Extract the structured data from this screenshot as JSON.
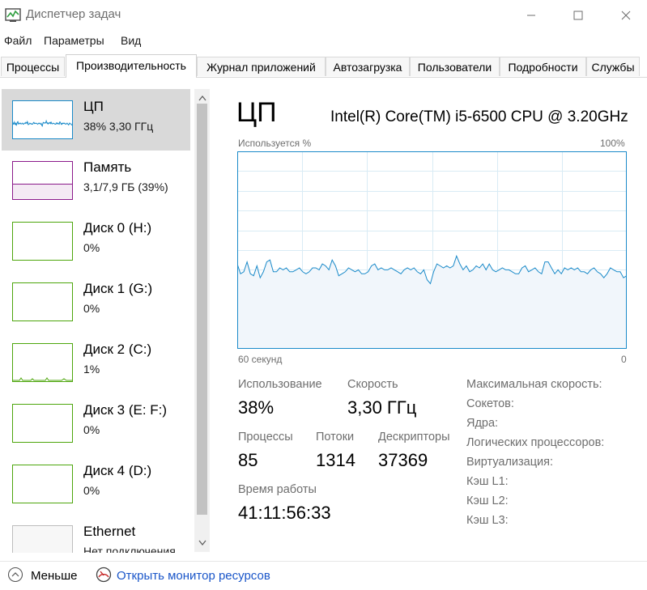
{
  "window": {
    "title": "Диспетчер задач",
    "minimize_icon": "minimize-icon",
    "maximize_icon": "maximize-icon",
    "close_icon": "close-icon"
  },
  "menu": [
    "Файл",
    "Параметры",
    "Вид"
  ],
  "tabs": [
    "Процессы",
    "Производительность",
    "Журнал приложений",
    "Автозагрузка",
    "Пользователи",
    "Подробности",
    "Службы"
  ],
  "active_tab": "Производительность",
  "sidebar": {
    "items": [
      {
        "name": "ЦП",
        "sub": "38% 3,30 ГГц",
        "color": "#1a8ac9",
        "selected": true
      },
      {
        "name": "Память",
        "sub": "3,1/7,9 ГБ (39%)",
        "color": "#8b1a8b"
      },
      {
        "name": "Диск 0 (H:)",
        "sub": "0%",
        "color": "#4da60c"
      },
      {
        "name": "Диск 1 (G:)",
        "sub": "0%",
        "color": "#4da60c"
      },
      {
        "name": "Диск 2 (C:)",
        "sub": "1%",
        "color": "#4da60c"
      },
      {
        "name": "Диск 3 (E: F:)",
        "sub": "0%",
        "color": "#4da60c"
      },
      {
        "name": "Диск 4 (D:)",
        "sub": "0%",
        "color": "#4da60c"
      },
      {
        "name": "Ethernet",
        "sub": "Нет подключения",
        "color": "#bdbdbd"
      }
    ]
  },
  "main": {
    "title": "ЦП",
    "cpu_model": "Intel(R) Core(TM) i5-6500 CPU @ 3.20GHz",
    "graph_top_left": "Используется %",
    "graph_top_right": "100%",
    "graph_bottom_left": "60 секунд",
    "graph_bottom_right": "0",
    "graph_color": "#1a8ac9",
    "graph_fill": "#f1f6fb",
    "graph_grid": "#d9ebf5",
    "cpu_usage_history": [
      43,
      38,
      39,
      44,
      38,
      37,
      42,
      36,
      39,
      44,
      45,
      39,
      39,
      41,
      40,
      41,
      39,
      39,
      40,
      41,
      39,
      38,
      39,
      41,
      41,
      40,
      43,
      42,
      40,
      45,
      42,
      37,
      38,
      39,
      41,
      40,
      39,
      40,
      38,
      38,
      39,
      42,
      43,
      40,
      41,
      40,
      40,
      41,
      40,
      39,
      38,
      40,
      41,
      40,
      41,
      39,
      38,
      40,
      35,
      33,
      39,
      43,
      42,
      41,
      42,
      41,
      42,
      47,
      43,
      40,
      42,
      39,
      40,
      42,
      41,
      43,
      40,
      43,
      40,
      39,
      40,
      41,
      40,
      40,
      39,
      38,
      38,
      41,
      42,
      39,
      40,
      41,
      39,
      38,
      44,
      44,
      41,
      38,
      40,
      38,
      41,
      40,
      41,
      40,
      41,
      39,
      39,
      38,
      40,
      41,
      39,
      38,
      36,
      38,
      41,
      40,
      39,
      39,
      36,
      37
    ]
  },
  "stats": {
    "usage_label": "Использование",
    "usage_value": "38%",
    "speed_label": "Скорость",
    "speed_value": "3,30 ГГц",
    "processes_label": "Процессы",
    "processes_value": "85",
    "threads_label": "Потоки",
    "threads_value": "1314",
    "handles_label": "Дескрипторы",
    "handles_value": "37369",
    "uptime_label": "Время работы",
    "uptime_value": "41:11:56:33"
  },
  "specs": [
    "Максимальная скорость:",
    "Сокетов:",
    "Ядра:",
    "Логических процессоров:",
    "Виртуализация:",
    "Кэш L1:",
    "Кэш L2:",
    "Кэш L3:"
  ],
  "footer": {
    "fewer_label": "Меньше",
    "monitor_label": "Открыть монитор ресурсов"
  }
}
